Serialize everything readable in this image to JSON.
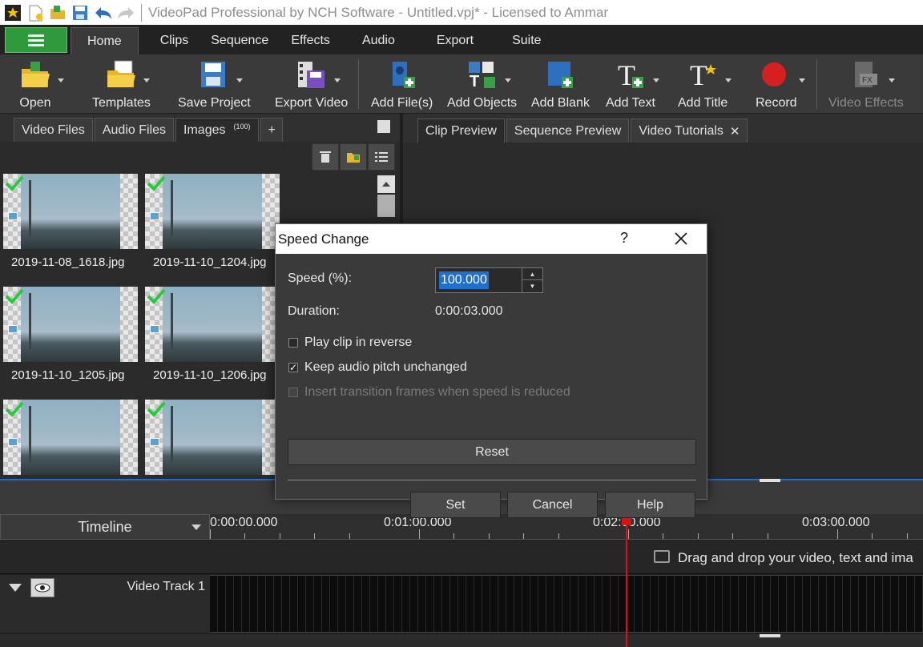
{
  "window": {
    "title": "VideoPad Professional by NCH Software - Untitled.vpj* - Licensed to Ammar"
  },
  "menu": {
    "tabs": [
      "Home",
      "Clips",
      "Sequence",
      "Effects",
      "Audio",
      "Export",
      "Suite"
    ],
    "active": "Home"
  },
  "toolbar": {
    "open": "Open",
    "templates": "Templates",
    "save_project": "Save Project",
    "export_video": "Export Video",
    "add_files": "Add File(s)",
    "add_objects": "Add Objects",
    "add_blank": "Add Blank",
    "add_text": "Add Text",
    "add_title": "Add Title",
    "record": "Record",
    "video_effects": "Video Effects"
  },
  "media_bin": {
    "tabs": [
      "Video Files",
      "Audio Files",
      "Images"
    ],
    "images_count": "(100)",
    "add_tab": "+",
    "items": [
      {
        "name": "2019-11-08_1618.jpg"
      },
      {
        "name": "2019-11-10_1204.jpg"
      },
      {
        "name": "2019-11-10_1205.jpg"
      },
      {
        "name": "2019-11-10_1206.jpg"
      },
      {
        "name": ""
      },
      {
        "name": ""
      }
    ]
  },
  "preview": {
    "tabs": [
      "Clip Preview",
      "Sequence Preview",
      "Video Tutorials"
    ],
    "close_glyph": "✕"
  },
  "timeline": {
    "label": "Timeline",
    "ticks": [
      "0:00:00.000",
      "0:01:00.000",
      "0:02:00.000",
      "0:03:00.000"
    ],
    "drop_hint": "Drag and drop your video, text and ima",
    "video_track": "Video Track 1"
  },
  "dialog": {
    "title": "Speed Change",
    "help_glyph": "?",
    "speed_label": "Speed (%):",
    "speed_value": "100.000",
    "duration_label": "Duration:",
    "duration_value": "0:00:03.000",
    "play_reverse": "Play clip in reverse",
    "keep_pitch": "Keep audio pitch unchanged",
    "insert_frames": "Insert transition frames when speed is reduced",
    "reset": "Reset",
    "set": "Set",
    "cancel": "Cancel",
    "help": "Help"
  },
  "colors": {
    "accent_green": "#2f9a3c",
    "selection_blue": "#1f6fcf",
    "playhead_red": "#e01010"
  }
}
